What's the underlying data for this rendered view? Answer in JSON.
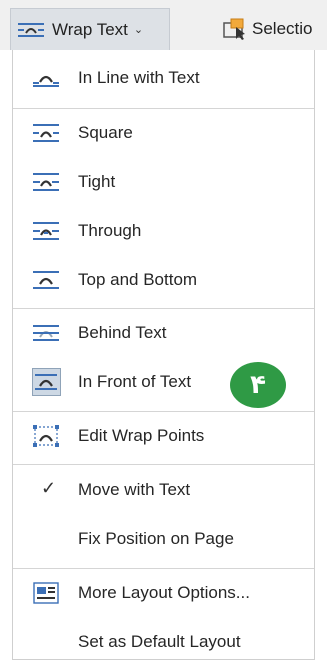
{
  "toolbar": {
    "wrap_text_label": "Wrap Text",
    "wrap_text_chevron": "⌄",
    "selection_label": "Selectio"
  },
  "menu": {
    "items": [
      {
        "label": "In Line with Text"
      },
      {
        "label": "Square"
      },
      {
        "label": "Tight"
      },
      {
        "label": "Through"
      },
      {
        "label": "Top and Bottom"
      },
      {
        "label": "Behind Text"
      },
      {
        "label": "In Front of Text"
      },
      {
        "label": "Edit Wrap Points"
      },
      {
        "label": "Move with Text",
        "checked": true
      },
      {
        "label": "Fix Position on Page"
      },
      {
        "label": "More Layout Options..."
      },
      {
        "label": "Set as Default Layout"
      }
    ]
  },
  "annotation": {
    "badge_text": "۴"
  },
  "colors": {
    "accent_blue": "#3b6fb6",
    "badge_green": "#2f9a45",
    "highlight": "#cdd8e4"
  }
}
